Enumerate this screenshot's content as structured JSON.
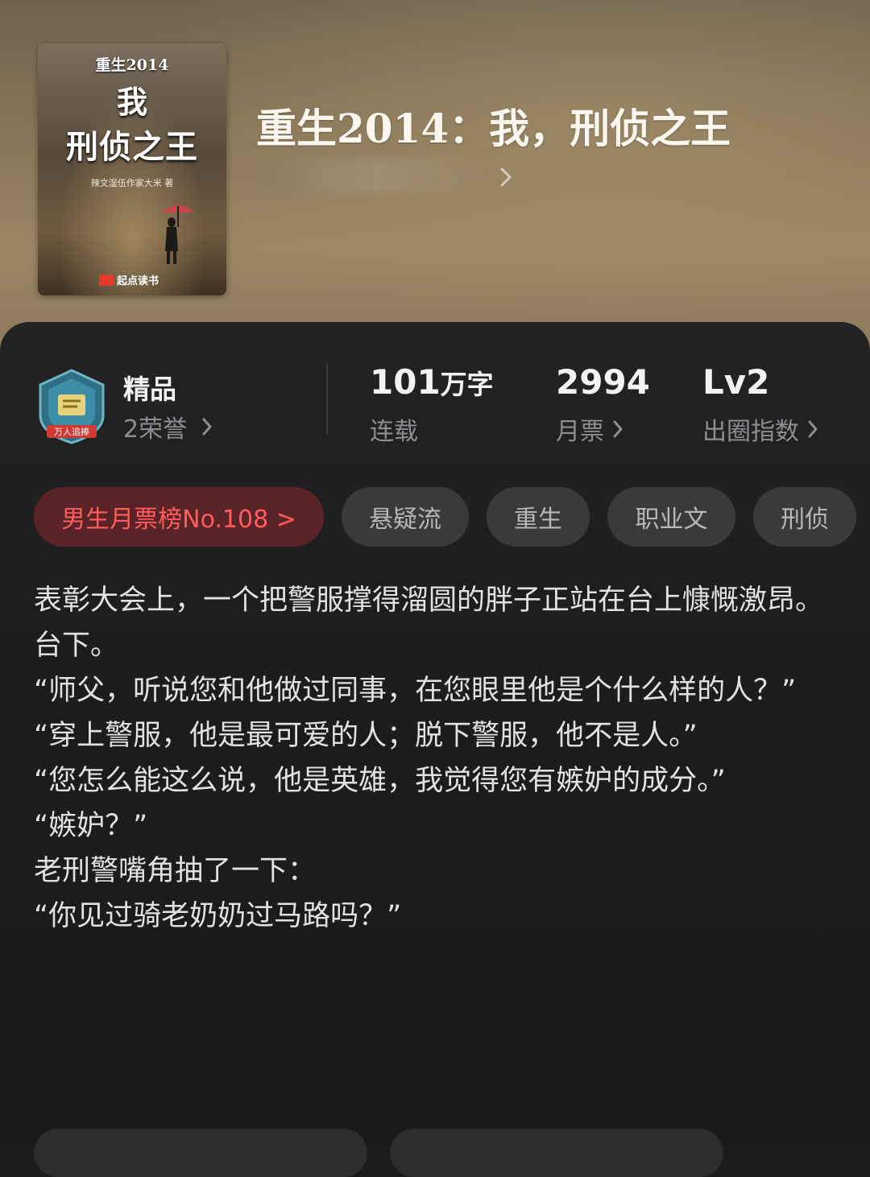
{
  "book": {
    "title": "重生2014：我，刑侦之王",
    "cover": {
      "top_text": "重生2014",
      "mid_text": "我",
      "main_text": "刑侦之王",
      "author_text": "辣文湿伍作家大米 著",
      "publisher": "起点读书"
    }
  },
  "stats": {
    "quality_title": "精品",
    "honors": "2荣誉",
    "badge_text": "万人追捧",
    "word_count": "101",
    "word_unit": "万字",
    "status": "连载",
    "monthly_votes": "2994",
    "monthly_votes_label": "月票",
    "level": "Lv2",
    "level_label": "出圈指数"
  },
  "tags": {
    "rank": "男生月票榜No.108 >",
    "items": [
      "悬疑流",
      "重生",
      "职业文",
      "刑侦"
    ]
  },
  "intro": [
    "表彰大会上，一个把警服撑得溜圆的胖子正站在台上慷慨激昂。",
    "台下。",
    "“师父，听说您和他做过同事，在您眼里他是个什么样的人？”",
    "“穿上警服，他是最可爱的人；脱下警服，他不是人。”",
    "“您怎么能这么说，他是英雄，我觉得您有嫉妒的成分。”",
    "“嫉妒？”",
    "老刑警嘴角抽了一下：",
    "“你见过骑老奶奶过马路吗？”"
  ],
  "colors": {
    "panel_bg": "#1c1c1d",
    "rank_bg": "#5a2327",
    "rank_text": "#ff5d5d",
    "tag_bg": "#3a3a3c"
  }
}
